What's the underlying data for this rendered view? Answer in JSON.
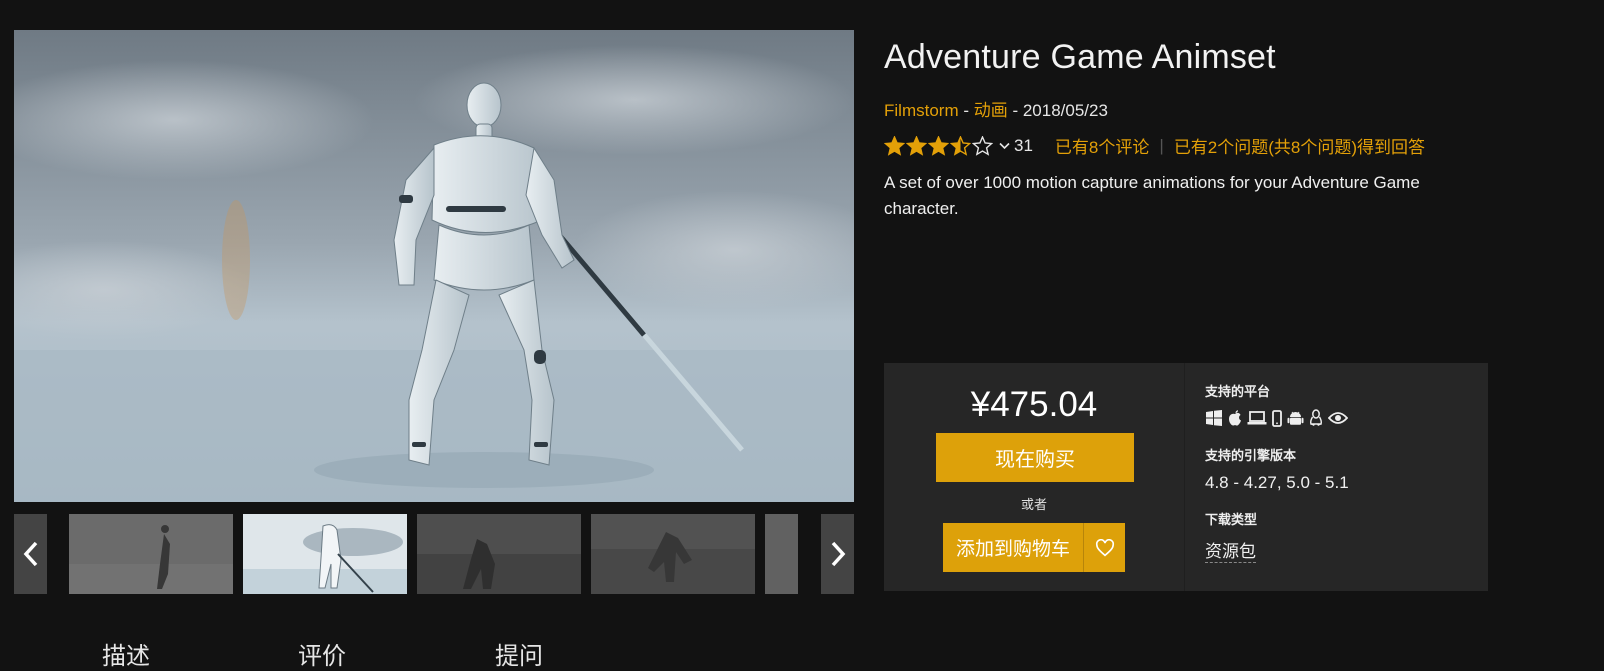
{
  "product": {
    "title": "Adventure Game Animset",
    "seller": "Filmstorm",
    "meta_sep1": " - ",
    "category": "动画",
    "meta_sep2": " - ",
    "date": "2018/05/23",
    "rating_value": 3.5,
    "rating_count": "31",
    "reviews_link": "已有8个评论",
    "qa_separator": "|",
    "qa_link": "已有2个问题(共8个问题)得到回答",
    "description": "A set of over 1000 motion capture animations for your Adventure Game character."
  },
  "gallery": {
    "thumbnails": [
      "thumbnail-1",
      "thumbnail-2",
      "thumbnail-3",
      "thumbnail-4",
      "thumbnail-5"
    ],
    "selected_index": 1,
    "prev_icon": "chevron-left-icon",
    "next_icon": "chevron-right-icon"
  },
  "purchase": {
    "price": "¥475.04",
    "buy_now": "现在购买",
    "or": "或者",
    "add_to_cart": "添加到购物车",
    "wishlist_icon": "heart-icon",
    "accent_color": "#dda10a"
  },
  "specs": {
    "platforms_label": "支持的平台",
    "platforms": [
      "windows-icon",
      "apple-icon",
      "laptop-icon",
      "mobile-icon",
      "android-icon",
      "linux-icon",
      "vr-eye-icon"
    ],
    "engine_label": "支持的引擎版本",
    "engine_versions": "4.8 - 4.27, 5.0 - 5.1",
    "download_label": "下载类型",
    "download_type": "资源包"
  },
  "tabs": [
    "描述",
    "评价",
    "提问"
  ]
}
